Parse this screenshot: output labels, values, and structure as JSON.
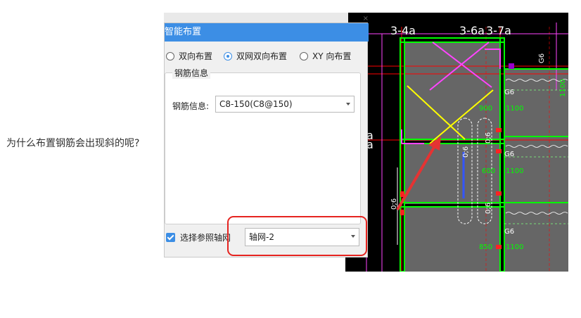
{
  "question": "为什么布置钢筋会出现斜的呢?",
  "dialog": {
    "title": "智能布置",
    "close": "×",
    "radios": [
      {
        "label": "双向布置",
        "checked": false
      },
      {
        "label": "双网双向布置",
        "checked": true
      },
      {
        "label": "XY 向布置",
        "checked": false
      }
    ],
    "group_title": "钢筋信息",
    "rebar_label": "钢筋信息:",
    "rebar_value": "C8-150(C8@150)",
    "axis_checkbox_label": "选择参照轴网",
    "axis_checked": true,
    "axis_value": "轴网-2"
  },
  "cad": {
    "axis_labels": [
      "3-4a",
      "3-6a",
      "3-7a"
    ],
    "side_labels": [
      "a",
      "a"
    ],
    "dims": [
      "900",
      "1100",
      "600",
      "1100",
      "850",
      "1100"
    ],
    "rebar_marks": [
      "G6",
      "G6",
      "G6",
      "G6"
    ],
    "vertical_marks": [
      "0;6",
      "0;6",
      "0;6",
      "0;6",
      "1100",
      "G6"
    ],
    "colors": {
      "background": "#000000",
      "slab": "#6b6b6b",
      "beam": "#00ff00",
      "axis": "#ff0000",
      "diagonal_magenta": "#ff44ff",
      "diagonal_yellow": "#ffff00",
      "arrow": "#e53333"
    }
  }
}
